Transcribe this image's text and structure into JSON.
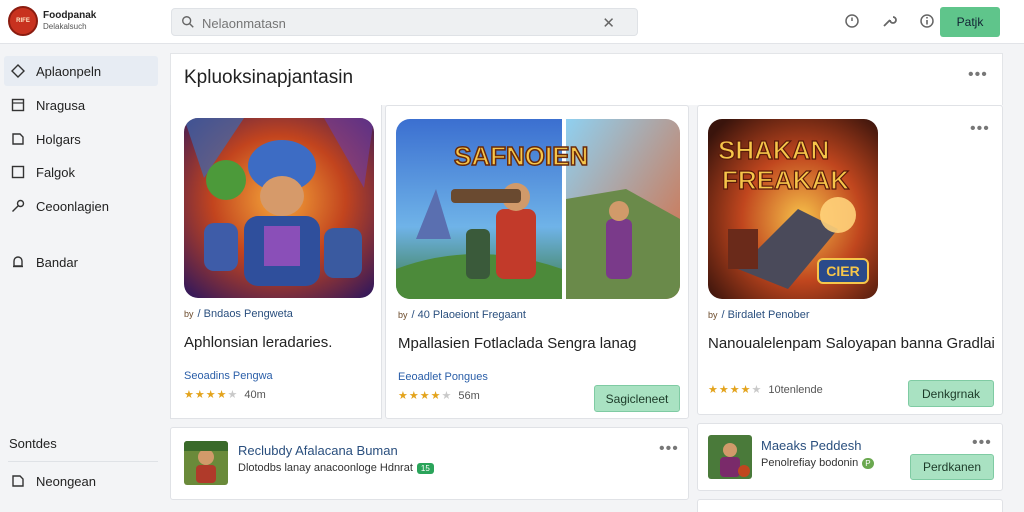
{
  "header": {
    "logo_text": "RIFE",
    "brand_line1": "Foodpanak",
    "brand_line2": "Delakalsuch",
    "search_placeholder": "Nelaonmatasn",
    "action_button": "Patjk"
  },
  "sidebar": {
    "items": [
      {
        "label": "Aplaonpeln",
        "icon": "diamond-icon"
      },
      {
        "label": "Nragusa",
        "icon": "square-icon"
      },
      {
        "label": "Holgars",
        "icon": "note-icon"
      },
      {
        "label": "Falgok",
        "icon": "square-icon"
      },
      {
        "label": "Ceoonlagien",
        "icon": "key-icon"
      },
      {
        "label": "Bandar",
        "icon": "bell-icon"
      }
    ],
    "section_heading": "Sontdes",
    "bottom_items": [
      {
        "label": "Neongean",
        "icon": "note-icon"
      }
    ]
  },
  "main": {
    "title": "Kpluoksinapjantasin",
    "cards": [
      {
        "meta": "/ Bndaos Pengweta",
        "meta_tag": "by",
        "title": "Aphlonsian leradaries.",
        "link": "Seoadins Pengwa",
        "stars": 4,
        "rating_text": "40m",
        "thumb_text": ""
      },
      {
        "meta": "/ 40 Plaoeiont Fregaant",
        "meta_tag": "by",
        "title": "Mpallasien Fotlaclada Sengra lanag",
        "link": "Eeoadlet Pongues",
        "stars": 4,
        "rating_text": "56m",
        "thumb_text": "SAFNOIEN",
        "button": "Sagicleneet"
      },
      {
        "meta": "/ Birdalet Penober",
        "meta_tag": "by",
        "title": "Nanoualelenpam Saloyapan banna Gradlai",
        "link": "",
        "stars": 4,
        "rating_text": "10tenlende",
        "thumb_text_1": "SHAKAN",
        "thumb_text_2": "FREAKAK",
        "thumb_badge": "CIER",
        "button": "Denkgrnak"
      }
    ],
    "mini_cards": [
      {
        "title": "Reclubdy Afalacana Buman",
        "subtitle": "Dlotodbs lanay anacoonloge Hdnrat",
        "badge": "15"
      },
      {
        "title": "Maeaks Peddesh",
        "subtitle": "Penolrefiay bodonin",
        "badge": "P",
        "button": "Perdkanen"
      }
    ]
  }
}
